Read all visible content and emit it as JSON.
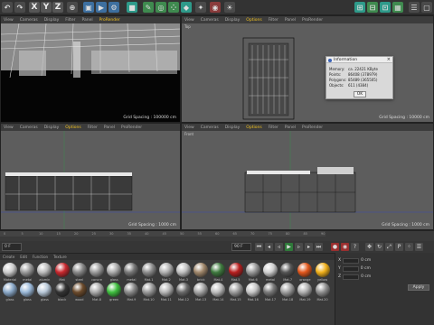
{
  "toolbar": {
    "axis_x": "X",
    "axis_y": "Y",
    "axis_z": "Z"
  },
  "viewports": {
    "perspective": {
      "menu": [
        "View",
        "Cameras",
        "Display",
        "Filter",
        "Panel",
        "ProRender"
      ],
      "grid_spacing": "Grid Spacing : 100000 cm"
    },
    "top": {
      "title": "Top",
      "menu": [
        "View",
        "Cameras",
        "Display",
        "Options",
        "Filter",
        "Panel",
        "ProRender"
      ],
      "grid_spacing": "Grid Spacing : 10000 cm"
    },
    "right": {
      "menu": [
        "View",
        "Cameras",
        "Display",
        "Options",
        "Filter",
        "Panel",
        "ProRender"
      ],
      "grid_spacing": "Grid Spacing : 1000 cm"
    },
    "front": {
      "title": "Front",
      "menu": [
        "View",
        "Cameras",
        "Display",
        "Options",
        "Filter",
        "Panel",
        "ProRender"
      ],
      "grid_spacing": "Grid Spacing : 1000 cm"
    }
  },
  "info_dialog": {
    "title": "Information",
    "rows": [
      {
        "label": "Memory:",
        "value": "ca. 22421 KByte"
      },
      {
        "label": "Points:",
        "value": "86408 (378979)"
      },
      {
        "label": "Polygons:",
        "value": "85489 (365505)"
      },
      {
        "label": "Objects:",
        "value": "611 (4384)"
      }
    ],
    "ok_label": "OK"
  },
  "timeline": {
    "ticks": [
      "0",
      "5",
      "10",
      "15",
      "20",
      "25",
      "30",
      "35",
      "40",
      "45",
      "50",
      "55",
      "60",
      "65",
      "70",
      "75",
      "80",
      "85",
      "90"
    ],
    "frame_start": "0 F",
    "frame_end": "90 F"
  },
  "materials": {
    "menu": [
      "Create",
      "Edit",
      "Function",
      "Texture"
    ],
    "row1": [
      "Material",
      "metal",
      "alumin",
      "Mat",
      "steel",
      "concre",
      "glass",
      "metal",
      "Mat.1",
      "Mat.2",
      "Mat.3",
      "brick",
      "Mat.4",
      "Mat.5",
      "Mat.6",
      "metal",
      "Mat.7",
      "orange",
      "yellow"
    ],
    "row2": [
      "glass",
      "glass",
      "glass",
      "black",
      "wood",
      "Mat.8",
      "green",
      "Mat.9",
      "Mat.10",
      "Mat.11",
      "Mat.12",
      "Mat.13",
      "Mat.14",
      "Mat.15",
      "Mat.16",
      "Mat.17",
      "Mat.18",
      "Mat.19",
      "Mat.20"
    ]
  },
  "attributes": {
    "fields": [
      {
        "label": "X",
        "value": "0 cm"
      },
      {
        "label": "Y",
        "value": "0 cm"
      },
      {
        "label": "Z",
        "value": "0 cm"
      }
    ],
    "apply_label": "Apply"
  }
}
